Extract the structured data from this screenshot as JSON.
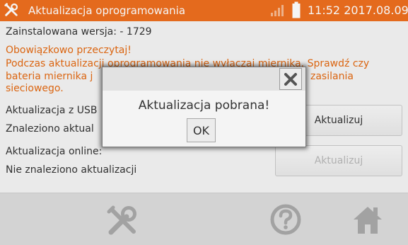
{
  "header": {
    "title": "Aktualizacja oprogramowania",
    "clock": "11:52 2017.08.09",
    "accent_color": "#ee6f1f",
    "icons": [
      "tools-icon",
      "signal-strength-icon",
      "battery-icon"
    ]
  },
  "main": {
    "installed_version": "Zainstalowana wersja: - 1729",
    "warning_title": "Obowiązkowo przeczytaj!",
    "warning_line1": "Podczas aktualizacji oprogramowania nie wyłączaj miernika. Sprawdź czy",
    "warning_line2_left": "bateria miernika j",
    "warning_line2_right": "zasilania",
    "warning_line3": "sieciowego.",
    "usb_label": "Aktualizacja z USB",
    "usb_status": "Znaleziono aktual",
    "usb_button": "Aktualizuj",
    "online_label": "Aktualizacja online:",
    "online_status": "Nie znaleziono aktualizacji",
    "online_button": "Aktualizuj"
  },
  "dialog": {
    "message": "Aktualizacja pobrana!",
    "ok_label": "OK",
    "close_icon": "close-icon"
  },
  "footer": {
    "icons": [
      "tools-icon",
      "help-icon",
      "home-icon"
    ]
  }
}
